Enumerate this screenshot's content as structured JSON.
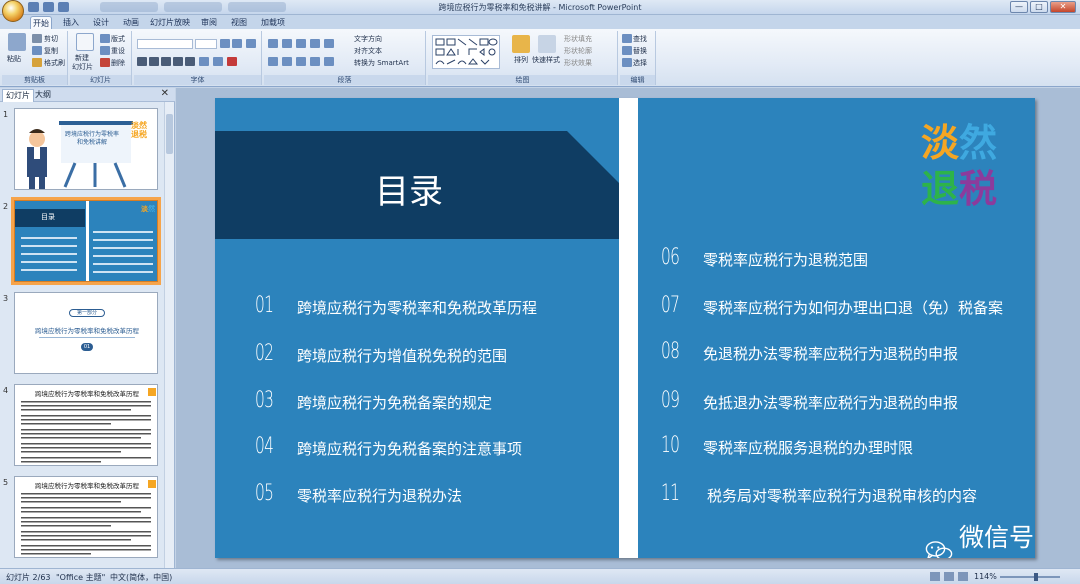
{
  "window": {
    "title": "跨境应税行为零税率和免税讲解 - Microsoft PowerPoint",
    "controls": [
      "—",
      "□",
      "✕"
    ]
  },
  "ribbon_tabs": [
    {
      "label": "开始",
      "active": true
    },
    {
      "label": "插入",
      "active": false
    },
    {
      "label": "设计",
      "active": false
    },
    {
      "label": "动画",
      "active": false
    },
    {
      "label": "幻灯片放映",
      "active": false
    },
    {
      "label": "审阅",
      "active": false
    },
    {
      "label": "视图",
      "active": false
    },
    {
      "label": "加载项",
      "active": false
    }
  ],
  "ribbon": {
    "clipboard": {
      "paste": "粘贴",
      "cut": "剪切",
      "copy": "复制",
      "format_painter": "格式刷",
      "label": "剪贴板"
    },
    "slides": {
      "new_slide": "新建",
      "new_slide2": "幻灯片",
      "layout": "版式",
      "reset": "重设",
      "delete": "删除",
      "label": "幻灯片"
    },
    "font": {
      "label": "字体"
    },
    "paragraph": {
      "text_direction": "文字方向",
      "align_text": "对齐文本",
      "smartart": "转换为 SmartArt",
      "label": "段落"
    },
    "drawing": {
      "arrange": "排列",
      "quick_styles": "快速样式",
      "shape_fill": "形状填充",
      "shape_outline": "形状轮廓",
      "shape_effects": "形状效果",
      "label": "绘图"
    },
    "editing": {
      "find": "查找",
      "replace": "替换",
      "select": "选择",
      "label": "编辑"
    }
  },
  "left_pane": {
    "tabs": [
      "幻灯片",
      "大纲"
    ],
    "close": "✕",
    "thumbnails": [
      {
        "num": "1",
        "title": "跨境应税行为零税率和免税讲解",
        "brand": "淡然退税"
      },
      {
        "num": "2",
        "title": "目录",
        "selected": true
      },
      {
        "num": "3",
        "tag": "第一部分",
        "title": "跨境应税行为零税率和免税改革历程",
        "num_badge": "01"
      },
      {
        "num": "4",
        "title": "跨境应税行为零税率和免税改革历程"
      },
      {
        "num": "5",
        "title": "跨境应税行为零税率和免税改革历程"
      }
    ]
  },
  "slide": {
    "title": "目录",
    "logo": {
      "line1": [
        "淡",
        "然"
      ],
      "line2": [
        "退",
        "税"
      ]
    },
    "left_items": [
      {
        "num": "01",
        "text": "跨境应税行为零税率和免税改革历程"
      },
      {
        "num": "02",
        "text": "跨境应税行为增值税免税的范围"
      },
      {
        "num": "03",
        "text": "跨境应税行为免税备案的规定"
      },
      {
        "num": "04",
        "text": "跨境应税行为免税备案的注意事项"
      },
      {
        "num": "05",
        "text": "零税率应税行为退税办法"
      }
    ],
    "right_items": [
      {
        "num": "06",
        "text": "零税率应税行为退税范围"
      },
      {
        "num": "07",
        "text": "零税率应税行为如何办理出口退（免）税备案"
      },
      {
        "num": "08",
        "text": "免退税办法零税率应税行为退税的申报"
      },
      {
        "num": "09",
        "text": "免抵退办法零税率应税行为退税的申报"
      },
      {
        "num": "10",
        "text": "零税率应税服务退税的办理时限"
      },
      {
        "num": "11",
        "text": "税务局对零税率应税行为退税审核的内容"
      }
    ],
    "watermark": "微信号: danrantuishui"
  },
  "status": {
    "slide_info": "幻灯片 2/63",
    "theme": "\"Office 主题\"",
    "language": "中文(简体，中国)",
    "zoom": "114%"
  },
  "colors": {
    "slide_bg": "#2c83bc",
    "title_band": "#0f3d63",
    "logo_orange": "#f5a623",
    "logo_blue": "#3fa9e0",
    "logo_green": "#2db34a",
    "logo_purple": "#8c3b9c"
  }
}
